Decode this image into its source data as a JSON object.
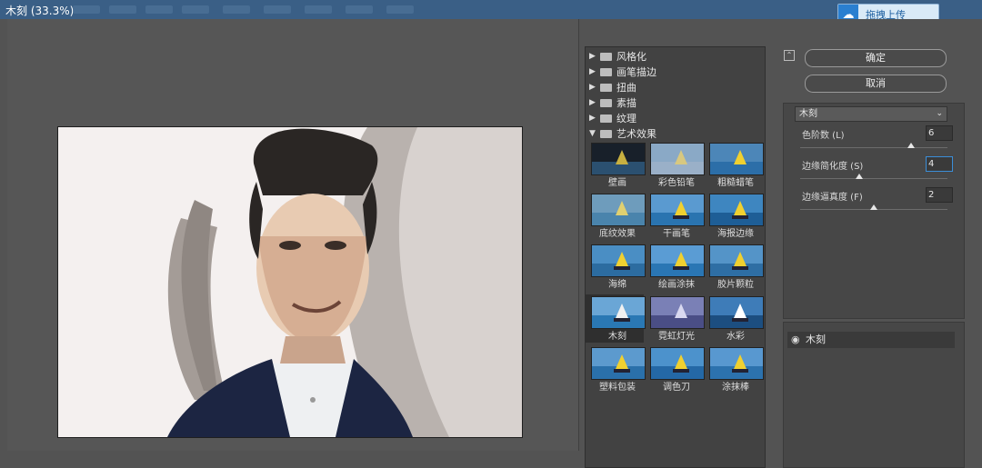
{
  "window": {
    "title": "木刻 (33.3%)"
  },
  "upload_button": {
    "label": "拖拽上传",
    "icon": "cloud-icon"
  },
  "gallery": {
    "folders": [
      "风格化",
      "画笔描边",
      "扭曲",
      "素描",
      "纹理"
    ],
    "open_folder": "艺术效果",
    "filters": [
      "壁画",
      "彩色铅笔",
      "粗糙蜡笔",
      "底纹效果",
      "干画笔",
      "海报边缘",
      "海绵",
      "绘画涂抹",
      "胶片颗粒",
      "木刻",
      "霓虹灯光",
      "水彩",
      "塑料包装",
      "调色刀",
      "涂抹棒"
    ],
    "selected": "木刻"
  },
  "buttons": {
    "ok": "确定",
    "cancel": "取消"
  },
  "effect_select": {
    "value": "木刻"
  },
  "params": [
    {
      "label": "色阶数 (L)",
      "value": "6",
      "level": 0.75
    },
    {
      "label": "边缘简化度 (S)",
      "value": "4",
      "level": 0.4
    },
    {
      "label": "边缘逼真度 (F)",
      "value": "2",
      "level": 0.5
    }
  ],
  "layers": [
    {
      "name": "木刻"
    }
  ],
  "colors": {
    "titlebar": "#3a5f86",
    "panel": "#535353",
    "accent": "#2a7fd0"
  }
}
